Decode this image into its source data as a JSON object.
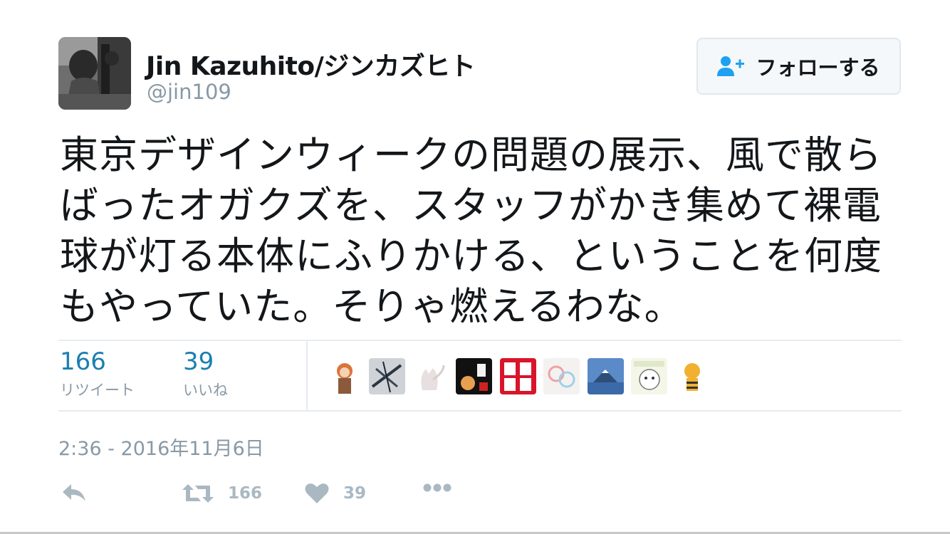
{
  "user": {
    "display_name": "Jin Kazuhito/ジンカズヒト",
    "handle": "@jin109"
  },
  "follow_button": {
    "label": "フォローする"
  },
  "tweet": {
    "lines": [
      "東京デザインウィークの問題の展示、風で散ら",
      "ばったオガクズを、スタッフがかき集めて裸電",
      "球が灯る本体にふりかける、ということを何度",
      "もやっていた。そりゃ燃えるわな。"
    ]
  },
  "stats": {
    "retweets": {
      "count": "166",
      "label": "リツイート"
    },
    "likes": {
      "count": "39",
      "label": "いいね"
    }
  },
  "likers": [
    "liker-avatar-1",
    "liker-avatar-2",
    "liker-avatar-3",
    "liker-avatar-4",
    "liker-avatar-5",
    "liker-avatar-6",
    "liker-avatar-7",
    "liker-avatar-8",
    "liker-avatar-9"
  ],
  "timestamp": "2:36 - 2016年11月6日",
  "actions": {
    "reply_icon": "reply-icon",
    "retweet_count": "166",
    "like_count": "39",
    "more_icon": "more-icon"
  },
  "colors": {
    "link_blue": "#1b7fb0",
    "muted": "#8899a6",
    "action_gray": "#aab8c2",
    "text": "#14171a",
    "divider": "#e6ecf0"
  }
}
